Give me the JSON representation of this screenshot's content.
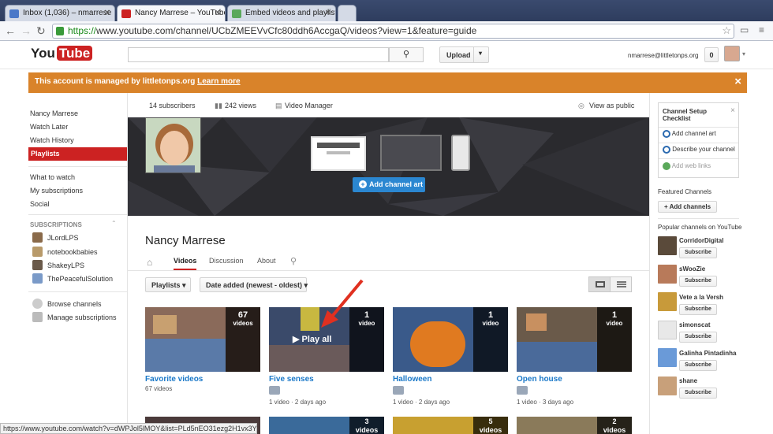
{
  "browser": {
    "tabs": [
      {
        "title": "Inbox (1,036) – nmarrese",
        "fav_color": "#4a78c8"
      },
      {
        "title": "Nancy Marrese – YouTube",
        "fav_color": "#cc2222"
      },
      {
        "title": "Embed videos and playlist",
        "fav_color": "#5aa85a"
      }
    ],
    "url_scheme": "https://",
    "url_rest": "www.youtube.com/channel/UCbZMEEVvCfc80ddh6AccgaQ/videos?view=1&feature=guide",
    "status_url": "https://www.youtube.com/watch?v=dWPJol5lMOY&list=PLd5nEO31ezg2H1vx3Y1..."
  },
  "header": {
    "logo_you": "You",
    "logo_tube": "Tube",
    "search_placeholder": "",
    "upload_label": "Upload",
    "account": "nmarrese@littletonps.org",
    "notifications": "0"
  },
  "banner": {
    "text": "This account is managed by littletonps.org",
    "link": "Learn more",
    "close": "×"
  },
  "sidebar": {
    "top_items": [
      "Nancy Marrese",
      "Watch Later",
      "Watch History"
    ],
    "active_item": "Playlists",
    "mid_items": [
      "What to watch",
      "My subscriptions",
      "Social"
    ],
    "subs_heading": "SUBSCRIPTIONS",
    "subscriptions": [
      {
        "name": "JLordLPS",
        "color": "#8a6a4a"
      },
      {
        "name": "notebookbabies",
        "color": "#b89a6a"
      },
      {
        "name": "ShakeyLPS",
        "color": "#6a5a4a"
      },
      {
        "name": "ThePeacefulSolution",
        "color": "#7a9ac8"
      }
    ],
    "browse": "Browse channels",
    "manage": "Manage subscriptions"
  },
  "channel": {
    "subscribers": "14 subscribers",
    "views": "242 views",
    "video_manager": "Video Manager",
    "view_as_public": "View as public",
    "add_art": "Add channel art",
    "name": "Nancy Marrese",
    "tabs": [
      "Videos",
      "Discussion",
      "About"
    ],
    "filter_playlists": "Playlists",
    "filter_sort": "Date added (newest - oldest)"
  },
  "playlists": [
    {
      "title": "Favorite videos",
      "count": "67",
      "count_label": "videos",
      "meta": "67 videos",
      "meta2": "",
      "bg": "#8a6a5a",
      "private": false
    },
    {
      "title": "Five senses",
      "count": "1",
      "count_label": "video",
      "meta": "",
      "meta2": "1 video  ·  2 days ago",
      "bg": "#3a4a6a",
      "private": true
    },
    {
      "title": "Halloween",
      "count": "1",
      "count_label": "video",
      "meta": "",
      "meta2": "1 video  ·  2 days ago",
      "bg": "#3a5a8a",
      "private": true
    },
    {
      "title": "Open house",
      "count": "1",
      "count_label": "video",
      "meta": "",
      "meta2": "1 video  ·  3 days ago",
      "bg": "#6a5a4a",
      "private": true
    }
  ],
  "play_all": "Play all",
  "row2": [
    {
      "count": "",
      "count_label": "",
      "bg": "#4a3a3a"
    },
    {
      "count": "3",
      "count_label": "videos",
      "bg": "#3a6a9a"
    },
    {
      "count": "5",
      "count_label": "videos",
      "bg": "#c8a030"
    },
    {
      "count": "2",
      "count_label": "videos",
      "bg": "#8a7a5a"
    }
  ],
  "checklist": {
    "title": "Channel Setup Checklist",
    "items": [
      "Add channel art",
      "Describe your channel"
    ],
    "done": "Add web links"
  },
  "featured": {
    "heading": "Featured Channels",
    "add_button": "+ Add channels"
  },
  "popular": {
    "heading": "Popular channels on YouTube",
    "subscribe_label": "Subscribe",
    "channels": [
      {
        "name": "CorridorDigital",
        "color": "#5a4a3a"
      },
      {
        "name": "sWooZie",
        "color": "#b87a5a"
      },
      {
        "name": "Vete a la Versh",
        "color": "#c89a3a"
      },
      {
        "name": "simonscat",
        "color": "#e8e8e8"
      },
      {
        "name": "Galinha Pintadinha",
        "color": "#6a9ad8"
      },
      {
        "name": "shane",
        "color": "#c8a07a"
      }
    ]
  }
}
